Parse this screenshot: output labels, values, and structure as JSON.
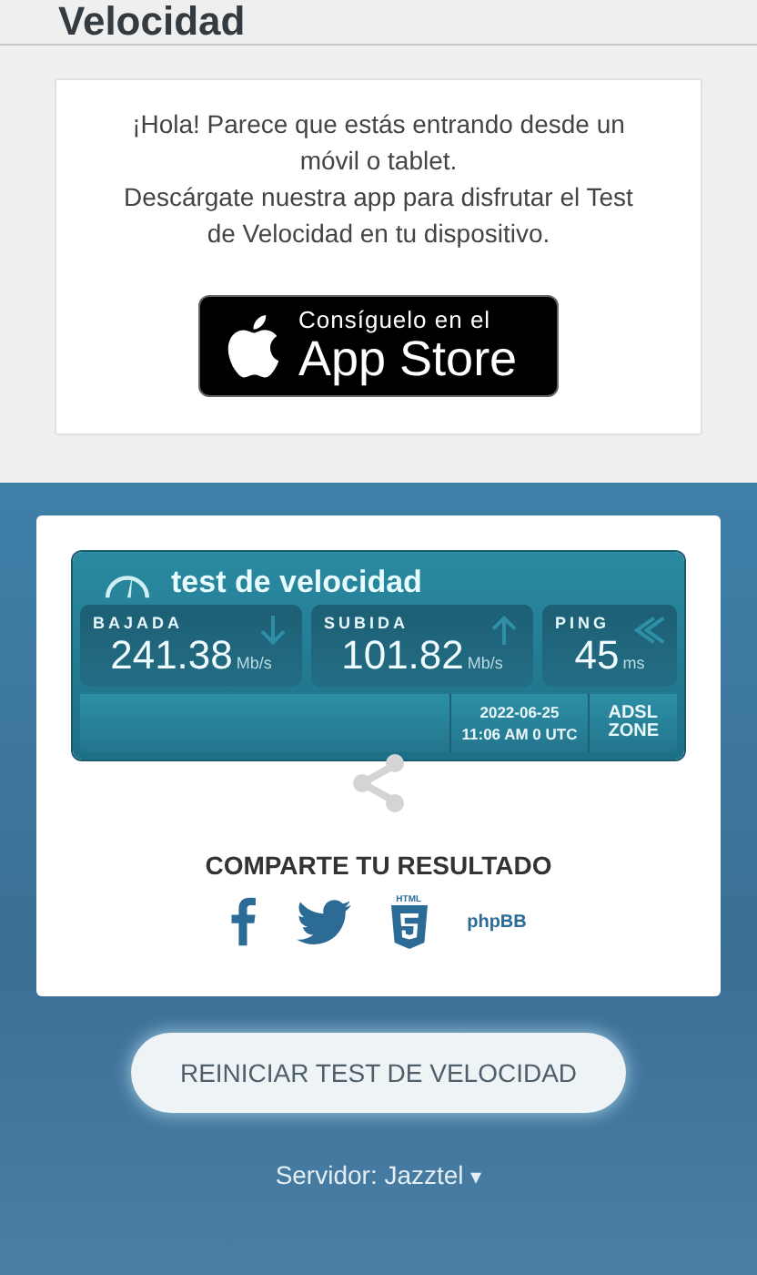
{
  "page_title": "Velocidad",
  "app_promo": {
    "message": "¡Hola! Parece que estás entrando desde un móvil o tablet.",
    "message_2": "Descárgate nuestra app para disfrutar el Test de Velocidad en tu dispositivo.",
    "badge_small": "Consíguelo en el",
    "badge_large": "App Store"
  },
  "result": {
    "title": "test de velocidad",
    "metrics": [
      {
        "label": "BAJADA",
        "value": "241.38",
        "unit": "Mb/s",
        "kind": "down"
      },
      {
        "label": "SUBIDA",
        "value": "101.82",
        "unit": "Mb/s",
        "kind": "up"
      },
      {
        "label": "PING",
        "value": "45",
        "unit": "ms",
        "kind": "ping"
      }
    ],
    "date": "2022-06-25",
    "time": "11:06 AM 0 UTC",
    "logo_top": "ADSL",
    "logo_bottom": "ZONE"
  },
  "share": {
    "title": "COMPARTE TU RESULTADO",
    "html_label": "HTML",
    "bb_label": "phpBB"
  },
  "restart_button": "REINICIAR TEST DE VELOCIDAD",
  "server": {
    "label": "Servidor: Jazztel",
    "arrow": "▾"
  }
}
